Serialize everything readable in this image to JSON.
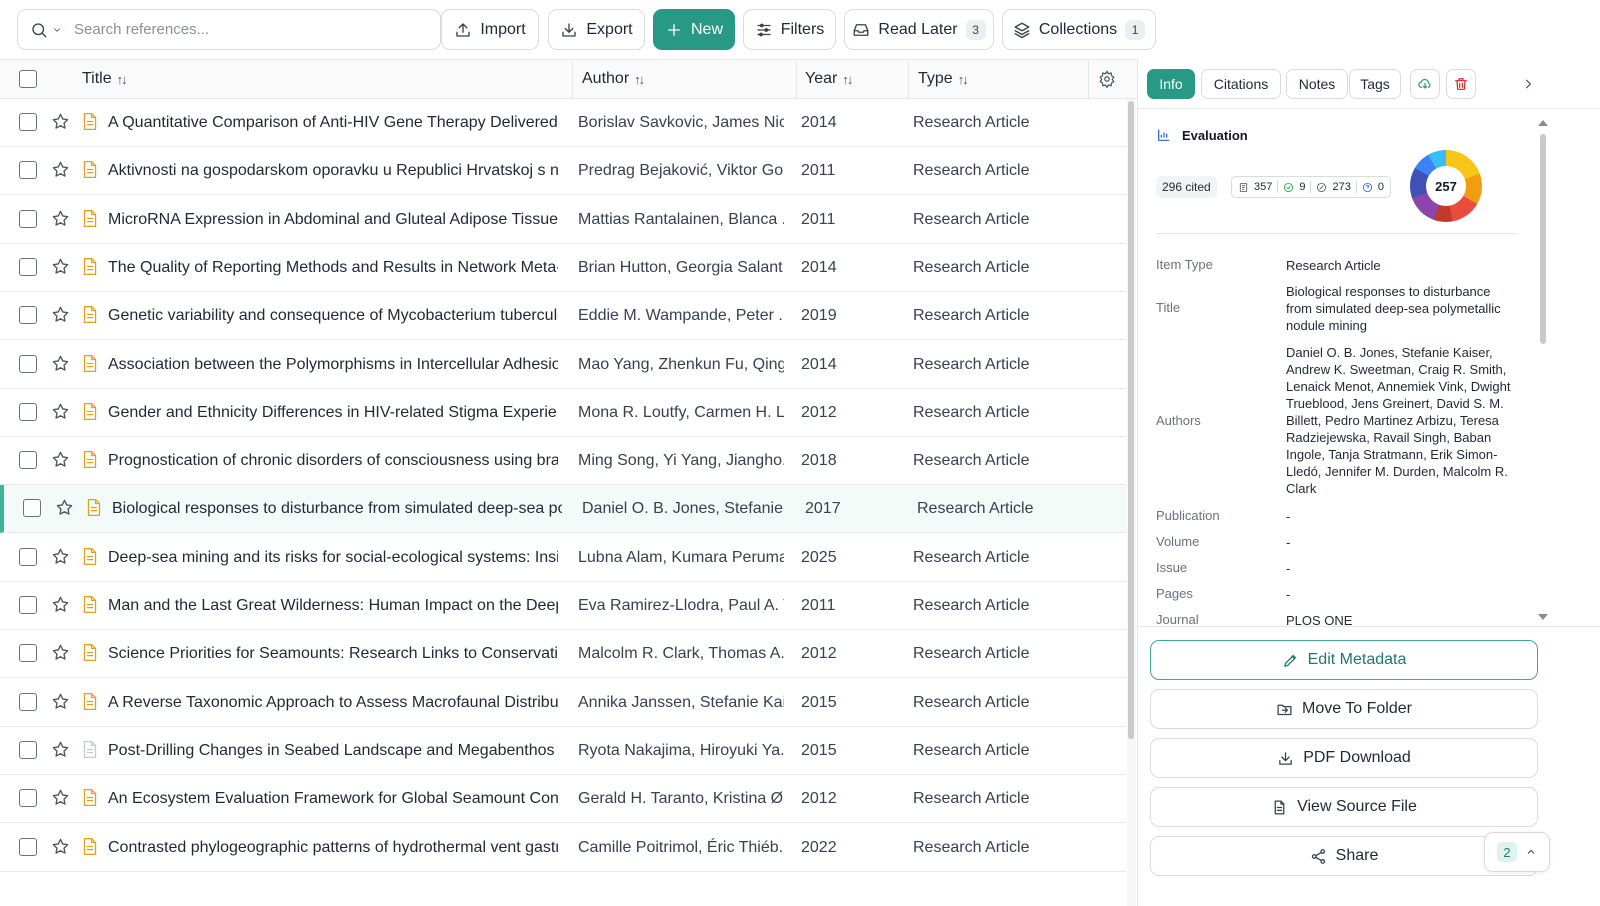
{
  "toolbar": {
    "search_placeholder": "Search references...",
    "import_label": "Import",
    "export_label": "Export",
    "new_label": "New",
    "filters_label": "Filters",
    "read_later_label": "Read Later",
    "read_later_count": "3",
    "collections_label": "Collections",
    "collections_count": "1"
  },
  "table": {
    "columns": {
      "title": "Title",
      "author": "Author",
      "year": "Year",
      "type": "Type"
    },
    "rows": [
      {
        "title": "A Quantitative Comparison of Anti-HIV Gene Therapy Delivered t...",
        "author": "Borislav Savkovic, James Nic...",
        "year": "2014",
        "type": "Research Article"
      },
      {
        "title": "Aktivnosti na gospodarskom oporavku u Republici Hrvatskoj s na...",
        "author": "Predrag Bejaković, Viktor Go...",
        "year": "2011",
        "type": "Research Article"
      },
      {
        "title": "MicroRNA Expression in Abdominal and Gluteal Adipose Tissue Is ...",
        "author": "Mattias Rantalainen, Blanca ...",
        "year": "2011",
        "type": "Research Article"
      },
      {
        "title": "The Quality of Reporting Methods and Results in Network Meta-A...",
        "author": "Brian Hutton, Georgia Salant...",
        "year": "2014",
        "type": "Research Article"
      },
      {
        "title": "Genetic variability and consequence of Mycobacterium tuberculos...",
        "author": "Eddie M. Wampande, Peter ...",
        "year": "2019",
        "type": "Research Article"
      },
      {
        "title": "Association between the Polymorphisms in Intercellular Adhesion ...",
        "author": "Mao Yang, Zhenkun Fu, Qing...",
        "year": "2014",
        "type": "Research Article"
      },
      {
        "title": "Gender and Ethnicity Differences in HIV-related Stigma Experience...",
        "author": "Mona R. Loutfy, Carmen H. L...",
        "year": "2012",
        "type": "Research Article"
      },
      {
        "title": "Prognostication of chronic disorders of consciousness using brain ...",
        "author": "Ming Song, Yi Yang, Jiangho...",
        "year": "2018",
        "type": "Research Article"
      },
      {
        "title": "Biological responses to disturbance from simulated deep-sea pol...",
        "author": "Daniel O. B. Jones, Stefanie K...",
        "year": "2017",
        "type": "Research Article"
      },
      {
        "title": "Deep-sea mining and its risks for social-ecological systems: Insigh...",
        "author": "Lubna Alam, Kumara Peruma...",
        "year": "2025",
        "type": "Research Article"
      },
      {
        "title": "Man and the Last Great Wilderness: Human Impact on the Deep S...",
        "author": "Eva Ramirez-Llodra, Paul A. T...",
        "year": "2011",
        "type": "Research Article"
      },
      {
        "title": "Science Priorities for Seamounts: Research Links to Conservation a...",
        "author": "Malcolm R. Clark, Thomas A. ...",
        "year": "2012",
        "type": "Research Article"
      },
      {
        "title": "A Reverse Taxonomic Approach to Assess Macrofaunal Distributio...",
        "author": "Annika Janssen, Stefanie Kais...",
        "year": "2015",
        "type": "Research Article"
      },
      {
        "title": "Post-Drilling Changes in Seabed Landscape and Megabenthos in ...",
        "author": "Ryota Nakajima, Hiroyuki Ya...",
        "year": "2015",
        "type": "Research Article"
      },
      {
        "title": "An Ecosystem Evaluation Framework for Global Seamount Conser...",
        "author": "Gerald H. Taranto, Kristina Ø....",
        "year": "2012",
        "type": "Research Article"
      },
      {
        "title": "Contrasted phylogeographic patterns of hydrothermal vent gastro...",
        "author": "Camille Poitrimol, Éric Thiéb...",
        "year": "2022",
        "type": "Research Article"
      }
    ]
  },
  "panel": {
    "tabs": {
      "info": "Info",
      "citations": "Citations",
      "notes": "Notes",
      "tags": "Tags"
    },
    "evaluation": {
      "heading": "Evaluation",
      "cited": "296 cited",
      "m1": "357",
      "m2": "9",
      "m3": "273",
      "m4": "0",
      "score": "257"
    },
    "fields": {
      "item_type_k": "Item Type",
      "item_type_v": "Research Article",
      "title_k": "Title",
      "title_v": "Biological responses to disturbance from simulated deep-sea polymetallic nodule mining",
      "authors_k": "Authors",
      "authors_v": "Daniel O. B. Jones, Stefanie Kaiser, Andrew K. Sweetman, Craig R. Smith, Lenaick Menot, Annemiek Vink, Dwight Trueblood, Jens Greinert, David S. M. Billett, Pedro Martinez Arbizu, Teresa Radziejewska, Ravail Singh, Baban Ingole, Tanja Stratmann, Erik Simon-Lledó, Jennifer M. Durden, Malcolm R. Clark",
      "publication_k": "Publication",
      "publication_v": "-",
      "volume_k": "Volume",
      "volume_v": "-",
      "issue_k": "Issue",
      "issue_v": "-",
      "pages_k": "Pages",
      "pages_v": "-",
      "journal_k": "Journal",
      "journal_v": "PLOS ONE"
    },
    "actions": {
      "edit": "Edit Metadata",
      "move": "Move To Folder",
      "pdf": "PDF Download",
      "source": "View Source File",
      "share": "Share"
    },
    "float_count": "2"
  }
}
